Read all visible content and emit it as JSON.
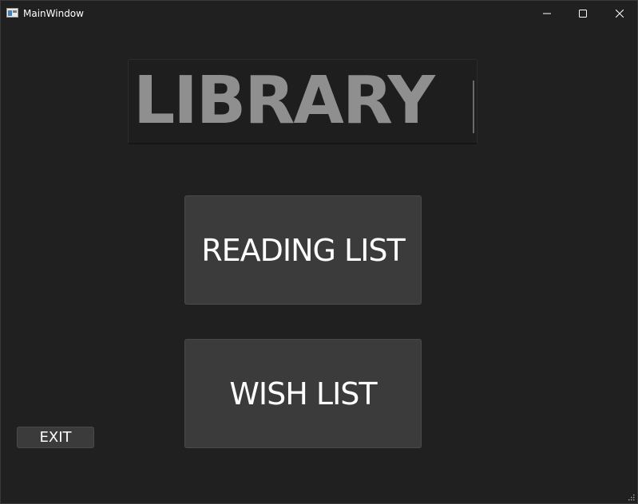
{
  "window": {
    "title": "MainWindow"
  },
  "titlebar": {
    "icons": [
      "app-icon",
      "minimize-icon",
      "maximize-icon",
      "close-icon"
    ]
  },
  "header": {
    "library_text": "LIBRARY"
  },
  "buttons": {
    "reading_list": "READING LIST",
    "wish_list": "WISH LIST",
    "exit": "EXIT"
  },
  "colors": {
    "background": "#202020",
    "button_bg": "#3b3b3b",
    "library_text": "#8f8f8f",
    "text": "#ffffff"
  }
}
